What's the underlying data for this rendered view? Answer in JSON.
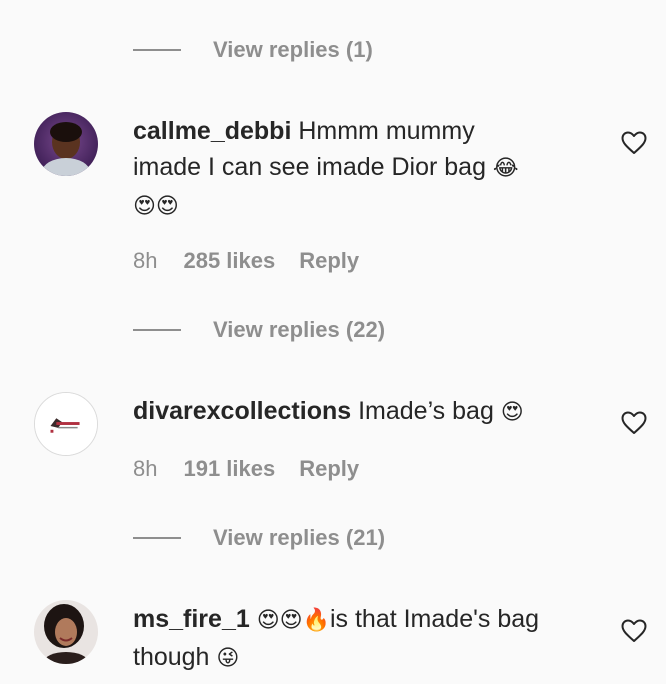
{
  "threads": [
    {
      "view_replies_label": "View replies (1)"
    }
  ],
  "comments": [
    {
      "username": "callme_debbi",
      "text_line1": " Hmmm mummy",
      "text_line2": "imade I can see imade Dior bag ",
      "emoji_laugh": "😂",
      "emoji_hearts": "😍😍",
      "time": "8h",
      "likes": "285 likes",
      "reply_label": "Reply",
      "view_replies_label": "View replies (22)",
      "avatar_icon": "profile-photo-avatar",
      "like_icon": "heart-outline-icon"
    },
    {
      "username": "divarexcollections",
      "text": " Imade’s bag ",
      "emoji_heart_eyes": "😍",
      "time": "8h",
      "likes": "191 likes",
      "reply_label": "Reply",
      "view_replies_label": "View replies (21)",
      "avatar_icon": "brand-logo-avatar",
      "like_icon": "heart-outline-icon"
    },
    {
      "username": "ms_fire_1",
      "emoji_lead": "😍😍🔥",
      "text_line1": "is that Imade's bag",
      "text_line2": "though ",
      "emoji_wink": "😜",
      "avatar_icon": "profile-photo-avatar",
      "like_icon": "heart-outline-icon"
    }
  ],
  "colors": {
    "background": "#fafafa",
    "primary_text": "#262626",
    "secondary_text": "#8e8e8e"
  }
}
